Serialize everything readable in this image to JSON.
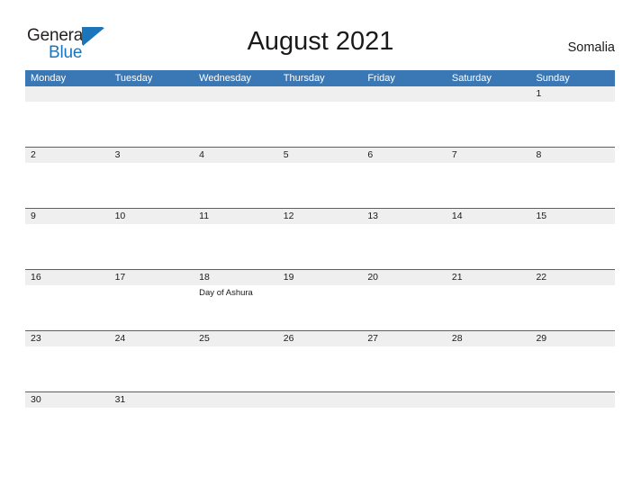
{
  "brand": {
    "name_part1": "General",
    "name_part2": "Blue",
    "flag_icon": "blue-triangle-flag-icon",
    "color_dark": "#231f20",
    "color_blue": "#1b75bb"
  },
  "header": {
    "title": "August 2021",
    "locale": "Somalia"
  },
  "theme": {
    "header_blue": "#3a78b5",
    "row_border_blue": "#2e6da4",
    "number_band_gray": "#efefef",
    "cell_white": "#ffffff"
  },
  "calendar": {
    "month": "August",
    "year": "2021",
    "weekday_headers": [
      "Monday",
      "Tuesday",
      "Wednesday",
      "Thursday",
      "Friday",
      "Saturday",
      "Sunday"
    ],
    "weeks": [
      {
        "days": [
          {
            "number": "",
            "events": []
          },
          {
            "number": "",
            "events": []
          },
          {
            "number": "",
            "events": []
          },
          {
            "number": "",
            "events": []
          },
          {
            "number": "",
            "events": []
          },
          {
            "number": "",
            "events": []
          },
          {
            "number": "1",
            "events": []
          }
        ]
      },
      {
        "days": [
          {
            "number": "2",
            "events": []
          },
          {
            "number": "3",
            "events": []
          },
          {
            "number": "4",
            "events": []
          },
          {
            "number": "5",
            "events": []
          },
          {
            "number": "6",
            "events": []
          },
          {
            "number": "7",
            "events": []
          },
          {
            "number": "8",
            "events": []
          }
        ]
      },
      {
        "days": [
          {
            "number": "9",
            "events": []
          },
          {
            "number": "10",
            "events": []
          },
          {
            "number": "11",
            "events": []
          },
          {
            "number": "12",
            "events": []
          },
          {
            "number": "13",
            "events": []
          },
          {
            "number": "14",
            "events": []
          },
          {
            "number": "15",
            "events": []
          }
        ]
      },
      {
        "days": [
          {
            "number": "16",
            "events": []
          },
          {
            "number": "17",
            "events": []
          },
          {
            "number": "18",
            "events": [
              "Day of Ashura"
            ]
          },
          {
            "number": "19",
            "events": []
          },
          {
            "number": "20",
            "events": []
          },
          {
            "number": "21",
            "events": []
          },
          {
            "number": "22",
            "events": []
          }
        ]
      },
      {
        "days": [
          {
            "number": "23",
            "events": []
          },
          {
            "number": "24",
            "events": []
          },
          {
            "number": "25",
            "events": []
          },
          {
            "number": "26",
            "events": []
          },
          {
            "number": "27",
            "events": []
          },
          {
            "number": "28",
            "events": []
          },
          {
            "number": "29",
            "events": []
          }
        ]
      },
      {
        "days": [
          {
            "number": "30",
            "events": []
          },
          {
            "number": "31",
            "events": []
          },
          {
            "number": "",
            "events": []
          },
          {
            "number": "",
            "events": []
          },
          {
            "number": "",
            "events": []
          },
          {
            "number": "",
            "events": []
          },
          {
            "number": "",
            "events": []
          }
        ]
      }
    ]
  }
}
